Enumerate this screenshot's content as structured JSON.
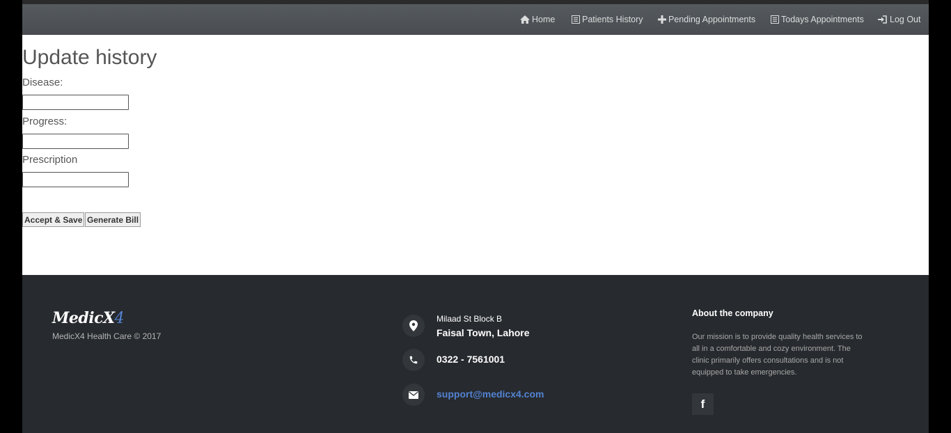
{
  "nav": {
    "home": "Home",
    "patients_history": "Patients History",
    "pending_appointments": "Pending Appointments",
    "todays_appointments": "Todays Appointments",
    "logout": "Log Out"
  },
  "page_title": "Update history",
  "form": {
    "disease_label": "Disease:",
    "disease_value": "",
    "progress_label": "Progress:",
    "progress_value": "",
    "prescription_label": "Prescription",
    "prescription_value": "",
    "accept_save_label": "Accept & Save",
    "generate_bill_label": "Generate Bill"
  },
  "footer": {
    "brand_main": "MedicX",
    "brand_accent": "4",
    "copyright": "MedicX4 Health Care © 2017",
    "address_line1": "Milaad St Block B",
    "address_line2": "Faisal Town, Lahore",
    "phone": "0322 - 7561001",
    "email": "support@medicx4.com",
    "about_title": "About the company",
    "about_text": "Our mission is to provide quality health services to all in a comfortable and cozy environment. The clinic primarily offers consultations and is not equipped to take emergencies.",
    "facebook_glyph": "f"
  },
  "icons": {
    "home": "home-icon",
    "patients_history": "list-icon",
    "pending_appointments": "plus-icon",
    "todays_appointments": "list-icon",
    "logout": "log-in-icon",
    "address": "map-marker-icon",
    "phone": "phone-icon",
    "email": "envelope-icon",
    "facebook": "facebook-icon"
  },
  "colors": {
    "navbar": "#4f5357",
    "footer": "#272a2e",
    "accent": "#5383d3",
    "title_text": "#555555"
  }
}
